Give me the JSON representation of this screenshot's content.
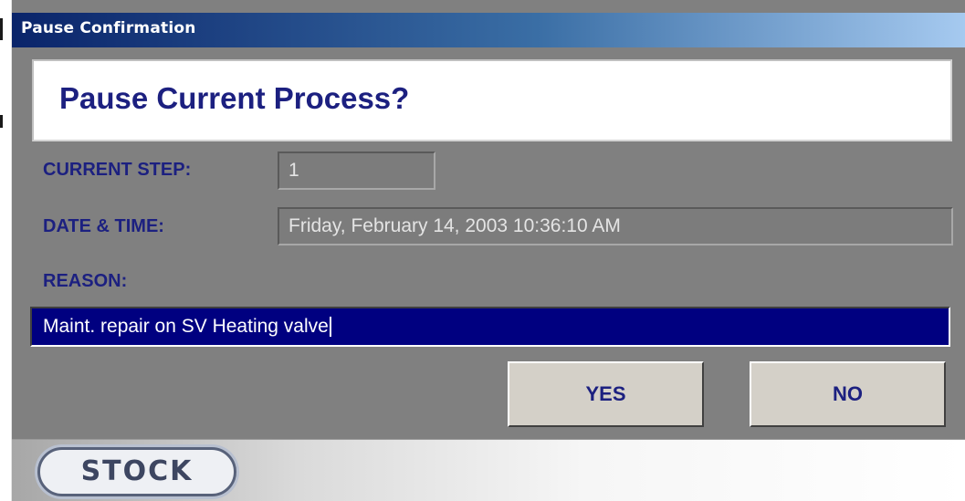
{
  "window": {
    "title": "Pause Confirmation"
  },
  "header": {
    "heading": "Pause Current Process?"
  },
  "fields": {
    "current_step_label": "CURRENT STEP:",
    "current_step_value": "1",
    "date_time_label": "DATE & TIME:",
    "date_time_value": "Friday, February 14, 2003  10:36:10 AM",
    "reason_label": "REASON:",
    "reason_value": "Maint. repair on SV Heating valve"
  },
  "buttons": {
    "yes_label": "YES",
    "no_label": "NO"
  },
  "footer": {
    "logo_text": "STOCK"
  },
  "colors": {
    "titlebar_start": "#0a246a",
    "titlebar_end": "#a6caf0",
    "label_text": "#1c2080",
    "panel_background": "#808080",
    "input_selection": "#000080",
    "button_face": "#d4d0c8"
  }
}
